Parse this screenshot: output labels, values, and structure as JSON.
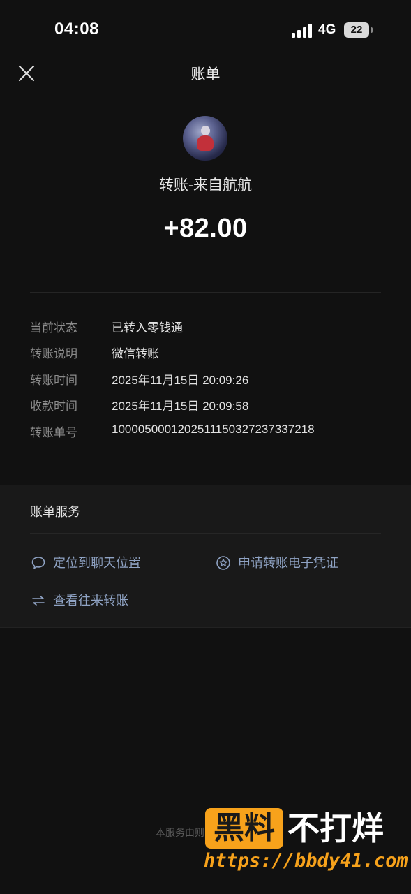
{
  "status_bar": {
    "time": "04:08",
    "network": "4G",
    "battery_level": "22",
    "signal_bars": 4
  },
  "nav": {
    "title": "账单",
    "close_icon": "close-icon"
  },
  "header": {
    "title": "转账-来自航航",
    "amount": "+82.00"
  },
  "details": [
    {
      "label": "当前状态",
      "value": "已转入零钱通"
    },
    {
      "label": "转账说明",
      "value": "微信转账"
    },
    {
      "label": "转账时间",
      "value": "2025年11月15日 20:09:26"
    },
    {
      "label": "收款时间",
      "value": "2025年11月15日 20:09:58"
    },
    {
      "label": "转账单号",
      "value": "1000050001202511150327237337218"
    }
  ],
  "services": {
    "title": "账单服务",
    "items": [
      {
        "label": "定位到聊天位置",
        "icon": "chat-bubble-icon"
      },
      {
        "label": "申请转账电子凭证",
        "icon": "star-badge-icon"
      },
      {
        "label": "查看往来转账",
        "icon": "swap-arrows-icon"
      }
    ]
  },
  "footer": {
    "text": "本服务由则"
  },
  "watermark": {
    "badge": "黑料",
    "main": "不打烊",
    "url": "https://bbdy41.com"
  },
  "colors": {
    "background": "#111111",
    "panel": "#191919",
    "link": "#8fa3c4",
    "watermark_accent": "#f7a21b"
  }
}
